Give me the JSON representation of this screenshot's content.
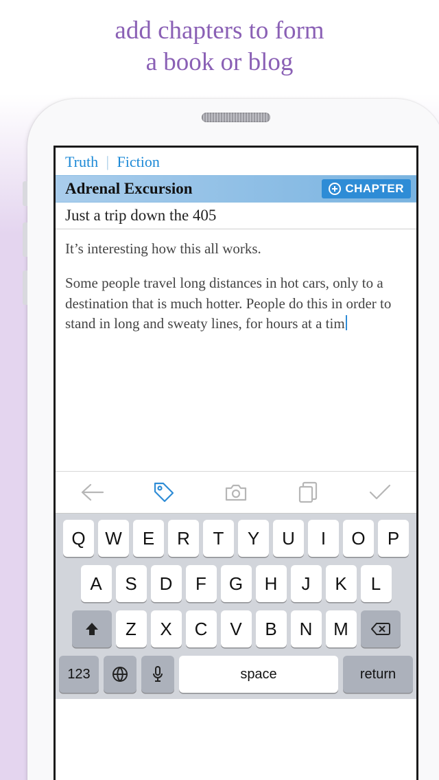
{
  "promo": {
    "line1": "add chapters to form",
    "line2": "a book or blog"
  },
  "breadcrumb": {
    "item1": "Truth",
    "item2": "Fiction"
  },
  "book": {
    "title": "Adrenal Excursion",
    "chapter_button": "CHAPTER",
    "subtitle": "Just a trip down the 405"
  },
  "editor": {
    "p1": "It’s interesting how this all works.",
    "p2": "Some people travel long distances in hot cars, only to a destination that is much hotter. People do this in order to stand in long and sweaty lines, for hours at a tim"
  },
  "keyboard": {
    "row1": [
      "Q",
      "W",
      "E",
      "R",
      "T",
      "Y",
      "U",
      "I",
      "O",
      "P"
    ],
    "row2": [
      "A",
      "S",
      "D",
      "F",
      "G",
      "H",
      "J",
      "K",
      "L"
    ],
    "row3": [
      "Z",
      "X",
      "C",
      "V",
      "B",
      "N",
      "M"
    ],
    "numbers": "123",
    "space": "space",
    "return": "return"
  }
}
